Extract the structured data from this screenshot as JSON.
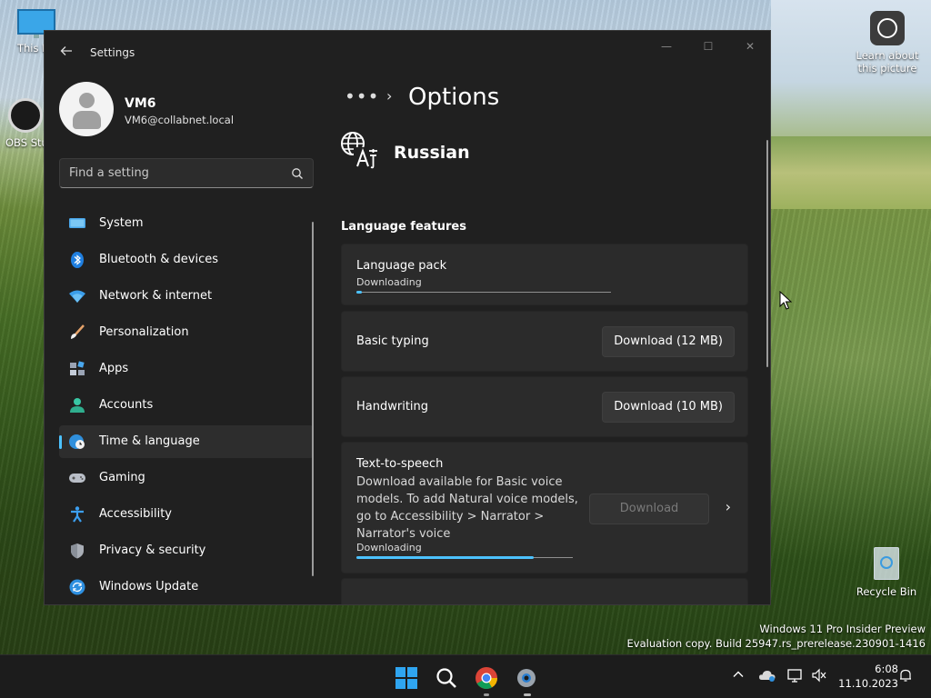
{
  "desktop": {
    "icons": [
      {
        "label": "This PC"
      },
      {
        "label": "OBS Studio"
      },
      {
        "label": "Learn about this picture"
      },
      {
        "label": "Recycle Bin"
      }
    ],
    "watermark_line1": "Windows 11 Pro Insider Preview",
    "watermark_line2": "Evaluation copy. Build 25947.rs_prerelease.230901-1416"
  },
  "window": {
    "app_title": "Settings",
    "controls": {
      "minimize": "—",
      "maximize": "☐",
      "close": "✕"
    }
  },
  "profile": {
    "name": "VM6",
    "email": "VM6@collabnet.local"
  },
  "search": {
    "placeholder": "Find a setting"
  },
  "nav": {
    "items": [
      {
        "label": "System",
        "icon": "system-icon"
      },
      {
        "label": "Bluetooth & devices",
        "icon": "bluetooth-icon"
      },
      {
        "label": "Network & internet",
        "icon": "wifi-icon"
      },
      {
        "label": "Personalization",
        "icon": "brush-icon"
      },
      {
        "label": "Apps",
        "icon": "apps-icon"
      },
      {
        "label": "Accounts",
        "icon": "person-icon"
      },
      {
        "label": "Time & language",
        "icon": "globe-clock-icon",
        "active": true
      },
      {
        "label": "Gaming",
        "icon": "gamepad-icon"
      },
      {
        "label": "Accessibility",
        "icon": "accessibility-icon"
      },
      {
        "label": "Privacy & security",
        "icon": "shield-icon"
      },
      {
        "label": "Windows Update",
        "icon": "update-icon"
      }
    ]
  },
  "main": {
    "breadcrumb_more": "•••",
    "title": "Options",
    "language": "Russian",
    "section_title": "Language features",
    "cards": {
      "language_pack": {
        "title": "Language pack",
        "status": "Downloading",
        "progress": 0.02
      },
      "basic_typing": {
        "title": "Basic typing",
        "button": "Download (12 MB)"
      },
      "handwriting": {
        "title": "Handwriting",
        "button": "Download (10 MB)"
      },
      "tts": {
        "title": "Text-to-speech",
        "description": "Download available for Basic voice models. To add Natural voice models, go to Accessibility > Narrator > Narrator's voice",
        "status": "Downloading",
        "progress": 0.82,
        "button": "Download"
      }
    }
  },
  "taskbar": {
    "apps": [
      "start-icon",
      "search-icon",
      "chrome-icon",
      "settings-icon"
    ],
    "clock_time": "6:08",
    "clock_date": "11.10.2023"
  },
  "colors": {
    "accent": "#4cc2ff",
    "window_bg": "#202020",
    "card_bg": "#2b2b2b"
  }
}
